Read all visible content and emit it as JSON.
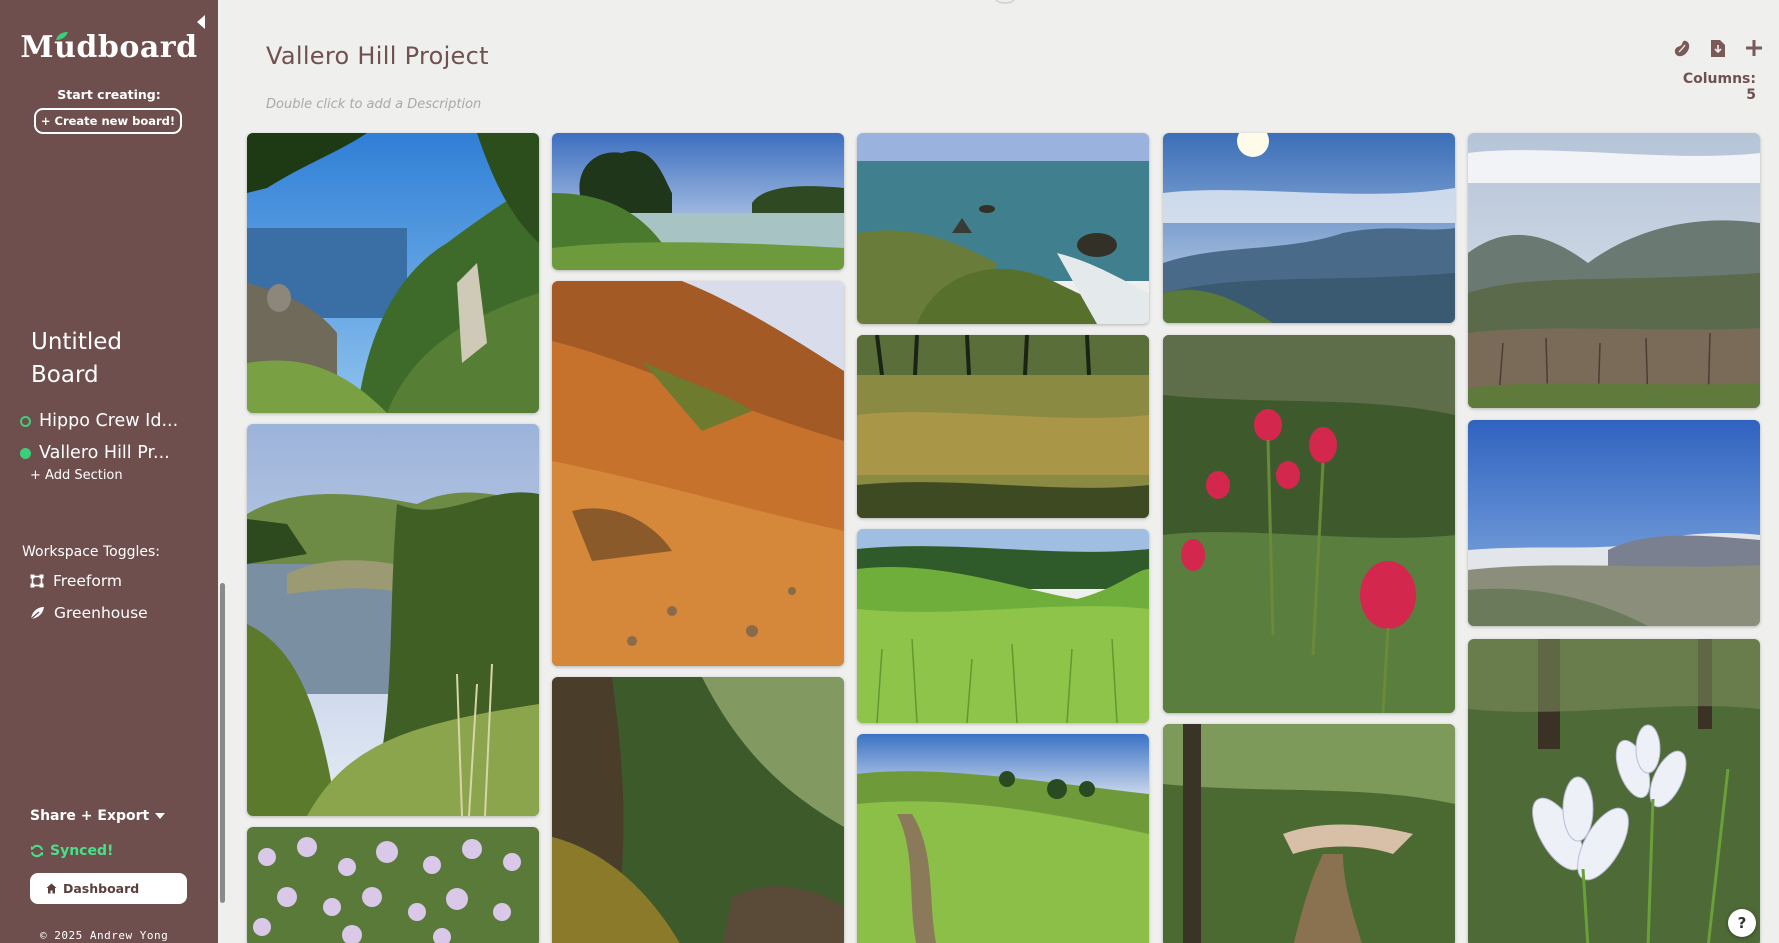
{
  "sidebar": {
    "logo": "Mudboard",
    "start_label": "Start creating:",
    "create_button": "+ Create new board!",
    "board_title": "Untitled Board",
    "sections": [
      {
        "label": "Hippo Crew Id...",
        "active": false
      },
      {
        "label": "Vallero Hill Pr...",
        "active": true
      }
    ],
    "add_section": "+ Add Section",
    "toggles_label": "Workspace Toggles:",
    "toggles": [
      {
        "label": "Freeform",
        "icon": "freeform-icon"
      },
      {
        "label": "Greenhouse",
        "icon": "greenhouse-leaf-icon"
      }
    ],
    "share_export": "Share + Export",
    "synced": "Synced!",
    "dashboard_button": "Dashboard",
    "copyright": "© 2025 Andrew Yong"
  },
  "main": {
    "title": "Vallero Hill Project",
    "description_placeholder": "Double click to add a Description",
    "columns_label": "Columns: 5",
    "toolbar_icons": [
      "bean-icon",
      "download-icon",
      "add-icon"
    ],
    "help_label": "?"
  },
  "colors": {
    "sidebar_bg": "#6e4f4d",
    "accent_green": "#3ccf7a",
    "synced_green": "#49e08a",
    "title_brown": "#6f5250"
  },
  "photos": [
    {
      "column": 1,
      "subject": "coastal cliffs with cypress trees and bridge"
    },
    {
      "column": 1,
      "subject": "lake with hills and tall grass"
    },
    {
      "column": 1,
      "subject": "purple wildflowers"
    },
    {
      "column": 2,
      "subject": "lagoon with cypress trees"
    },
    {
      "column": 2,
      "subject": "orange grassy hillside"
    },
    {
      "column": 2,
      "subject": "sunlit forest trunk"
    },
    {
      "column": 3,
      "subject": "ocean cove with rocks"
    },
    {
      "column": 3,
      "subject": "forest pond"
    },
    {
      "column": 3,
      "subject": "green grassy meadow"
    },
    {
      "column": 3,
      "subject": "trail through green hills"
    },
    {
      "column": 4,
      "subject": "mountain vista with sun"
    },
    {
      "column": 4,
      "subject": "red paintbrush flowers"
    },
    {
      "column": 4,
      "subject": "wooded trail"
    },
    {
      "column": 5,
      "subject": "hazy mountain ridges"
    },
    {
      "column": 5,
      "subject": "valley view under blue sky"
    },
    {
      "column": 5,
      "subject": "white iris flowers"
    }
  ]
}
